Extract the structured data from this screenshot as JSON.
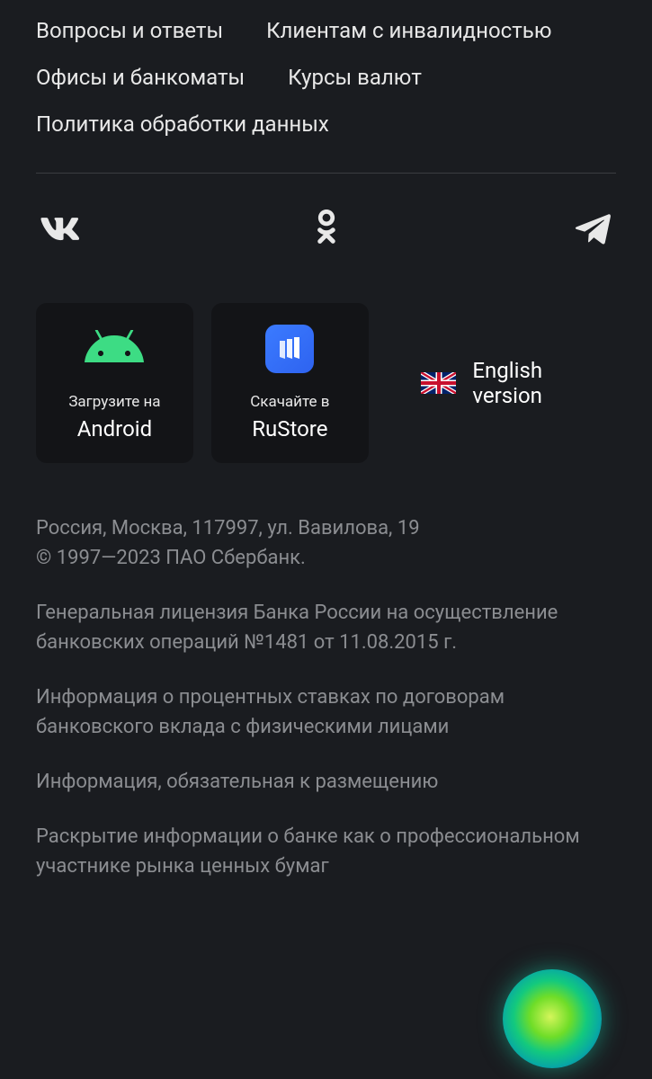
{
  "nav": {
    "links": [
      "Вопросы и ответы",
      "Клиентам с инвалидностью",
      "Офисы и банкоматы",
      "Курсы валют",
      "Политика обработки данных"
    ]
  },
  "apps": {
    "android": {
      "line1": "Загрузите на",
      "line2": "Android"
    },
    "rustore": {
      "line1": "Скачайте в",
      "line2": "RuStore"
    }
  },
  "language": {
    "label": "English version"
  },
  "legal": {
    "address": "Россия, Москва, 117997, ул. Вавилова, 19",
    "copyright": "© 1997—2023 ПАО Сбербанк.",
    "license": "Генеральная лицензия Банка России на осуществление банковских операций №1481 от 11.08.2015 г.",
    "links": [
      "Информация о процентных ставках по договорам банковского вклада с физическими лицами",
      "Информация, обязательная к размещению",
      "Раскрытие информации о банке как о профессиональном участнике рынка ценных бумаг"
    ]
  }
}
